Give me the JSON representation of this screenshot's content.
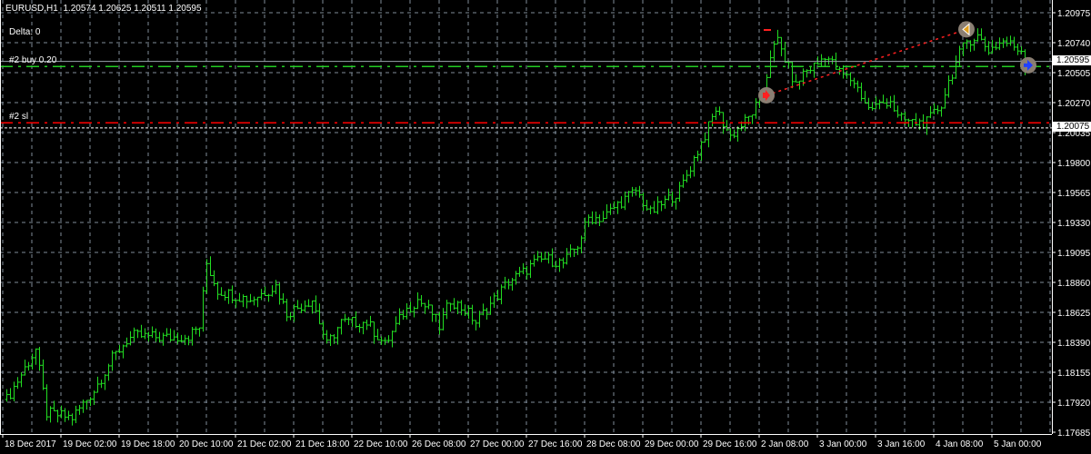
{
  "header": {
    "symbol": "EURUSD,H1",
    "ohlc": "1.20574 1.20625 1.20511 1.20595",
    "delta": "Delta: 0"
  },
  "orders": {
    "buy_label": "#2 buy 0.20",
    "sl_label": "#2 sl",
    "current_price_label": "1.20595",
    "sl_price_label": "1.20075"
  },
  "colors": {
    "background": "#000000",
    "bars": "#22dd22",
    "grid": "#7f8c99",
    "buy_line": "#22cc22",
    "sl_line": "#ff0000",
    "bid_line": "#9aa3ab"
  },
  "chart_data": {
    "type": "ohlc",
    "title": "EURUSD,H1",
    "ylim": [
      1.17685,
      1.20975
    ],
    "y_ticks": [
      "1.20975",
      "1.20740",
      "1.20505",
      "1.20270",
      "1.20035",
      "1.19800",
      "1.19565",
      "1.19330",
      "1.19095",
      "1.18860",
      "1.18625",
      "1.18390",
      "1.18155",
      "1.17920",
      "1.17685"
    ],
    "x_ticks": [
      "18 Dec 2017",
      "19 Dec 02:00",
      "19 Dec 18:00",
      "20 Dec 10:00",
      "21 Dec 02:00",
      "21 Dec 18:00",
      "22 Dec 10:00",
      "26 Dec 08:00",
      "27 Dec 00:00",
      "27 Dec 16:00",
      "28 Dec 08:00",
      "29 Dec 00:00",
      "29 Dec 16:00",
      "2 Jan 08:00",
      "3 Jan 00:00",
      "3 Jan 16:00",
      "4 Jan 08:00",
      "5 Jan 00:00"
    ],
    "bars_per_x_tick": 16,
    "close_keypoints": [
      [
        1,
        1.17955
      ],
      [
        9,
        1.18345
      ],
      [
        12,
        1.17848
      ],
      [
        19,
        1.17813
      ],
      [
        25,
        1.18026
      ],
      [
        30,
        1.18274
      ],
      [
        34,
        1.18416
      ],
      [
        36,
        1.18451
      ],
      [
        45,
        1.18437
      ],
      [
        51,
        1.18451
      ],
      [
        54,
        1.18522
      ],
      [
        56,
        1.19018
      ],
      [
        59,
        1.18805
      ],
      [
        68,
        1.18735
      ],
      [
        75,
        1.18841
      ],
      [
        78,
        1.18628
      ],
      [
        85,
        1.18735
      ],
      [
        89,
        1.1838
      ],
      [
        93,
        1.18557
      ],
      [
        100,
        1.18557
      ],
      [
        105,
        1.1838
      ],
      [
        110,
        1.18628
      ],
      [
        114,
        1.18735
      ],
      [
        118,
        1.18628
      ],
      [
        120,
        1.18522
      ],
      [
        123,
        1.18735
      ],
      [
        128,
        1.18628
      ],
      [
        130,
        1.18557
      ],
      [
        135,
        1.18735
      ],
      [
        139,
        1.18876
      ],
      [
        143,
        1.18947
      ],
      [
        146,
        1.19018
      ],
      [
        149,
        1.19054
      ],
      [
        154,
        1.19018
      ],
      [
        158,
        1.1916
      ],
      [
        161,
        1.19373
      ],
      [
        165,
        1.19373
      ],
      [
        169,
        1.19479
      ],
      [
        174,
        1.19585
      ],
      [
        178,
        1.19408
      ],
      [
        181,
        1.19479
      ],
      [
        186,
        1.19585
      ],
      [
        190,
        1.19834
      ],
      [
        194,
        1.20082
      ],
      [
        196,
        1.20223
      ],
      [
        200,
        1.20011
      ],
      [
        205,
        1.20153
      ],
      [
        209,
        1.2033
      ],
      [
        211,
        1.20649
      ],
      [
        213,
        1.20755
      ],
      [
        215,
        1.20613
      ],
      [
        218,
        1.20401
      ],
      [
        220,
        1.20507
      ],
      [
        224,
        1.20578
      ],
      [
        226,
        1.20649
      ],
      [
        230,
        1.20507
      ],
      [
        234,
        1.20436
      ],
      [
        238,
        1.20223
      ],
      [
        241,
        1.20259
      ],
      [
        244,
        1.20294
      ],
      [
        246,
        1.20153
      ],
      [
        250,
        1.20117
      ],
      [
        254,
        1.20117
      ],
      [
        258,
        1.20259
      ],
      [
        260,
        1.20436
      ],
      [
        263,
        1.20649
      ],
      [
        265,
        1.20755
      ],
      [
        268,
        1.20791
      ],
      [
        271,
        1.20684
      ],
      [
        275,
        1.20755
      ],
      [
        280,
        1.20684
      ],
      [
        281,
        1.20564
      ]
    ],
    "levels": {
      "bid": 1.20595,
      "buy_open": 1.20555,
      "stop_loss": 1.20115,
      "marker": 1.20075
    },
    "trade": {
      "entry_bar": 210,
      "entry_price": 1.2033,
      "exit_bar": 265,
      "exit_price": 1.20845,
      "close_bar": 281,
      "close_price": 1.20565
    }
  }
}
